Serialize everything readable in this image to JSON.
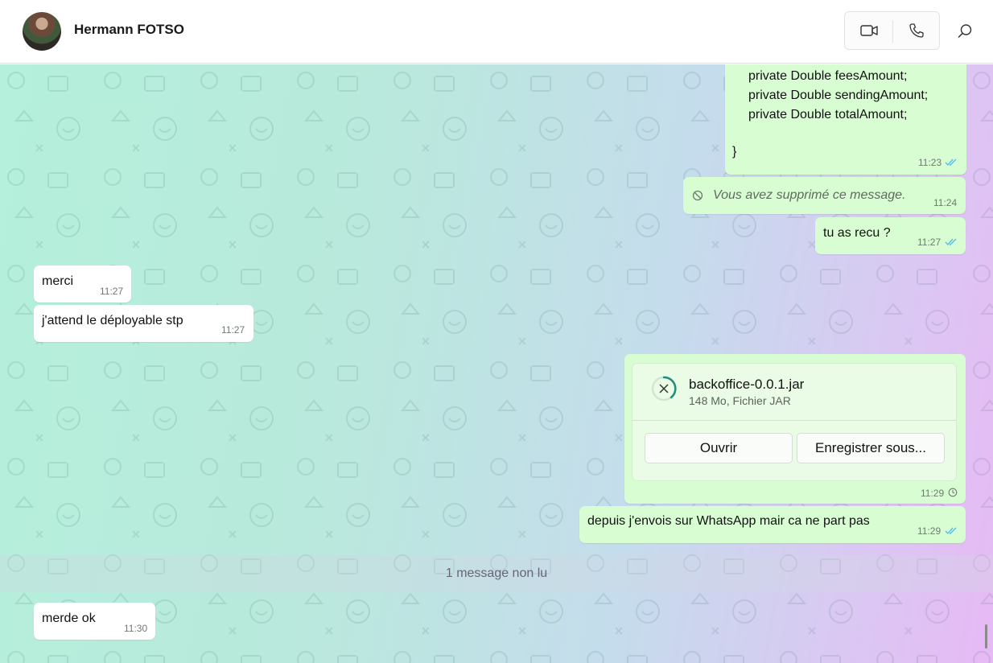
{
  "header": {
    "contact_name": "Hermann FOTSO",
    "icons": [
      "video-call-icon",
      "phone-call-icon",
      "search-icon"
    ]
  },
  "messages": {
    "code": {
      "lines": [
        "private Double feesAmount;",
        "private Double sendingAmount;",
        "private Double totalAmount;",
        "",
        "}"
      ],
      "time": "11:23"
    },
    "deleted": {
      "text": "Vous avez supprimé ce message.",
      "time": "11:24"
    },
    "tu_as_recu": {
      "text": "tu as recu ?",
      "time": "11:27"
    },
    "merci": {
      "text": "merci",
      "time": "11:27"
    },
    "deployable": {
      "text": "j'attend le déployable stp",
      "time": "11:27"
    },
    "file": {
      "name": "backoffice-0.0.1.jar",
      "meta": "148 Mo, Fichier JAR",
      "open_label": "Ouvrir",
      "save_label": "Enregistrer sous...",
      "time": "11:29"
    },
    "depuis": {
      "text": "depuis j'envois sur WhatsApp mair ca ne part pas",
      "time": "11:29"
    },
    "unread_divider": "1 message non lu",
    "merde_ok": {
      "text": "merde ok",
      "time": "11:30"
    }
  },
  "colors": {
    "outgoing_bubble": "#d9fdd3",
    "incoming_bubble": "#ffffff",
    "read_tick": "#53bdeb",
    "progress_ring": "#1f8f7a"
  }
}
